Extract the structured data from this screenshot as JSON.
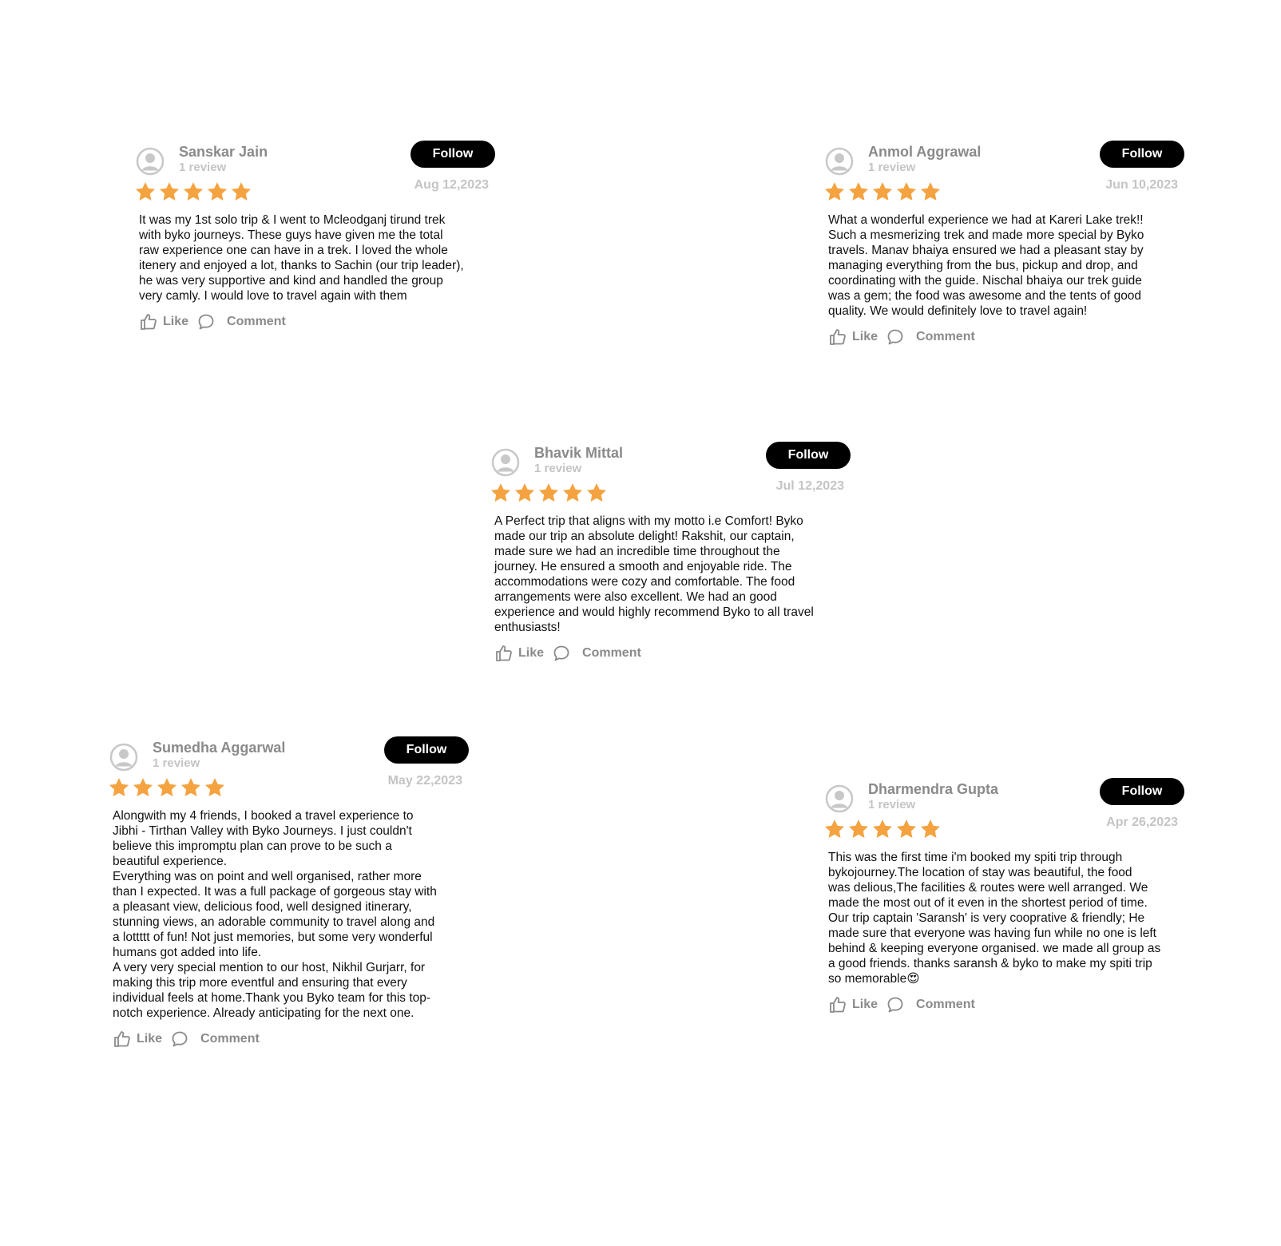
{
  "colors": {
    "star": "#F4A340",
    "follow_bg": "#000000",
    "follow_text": "#FFFFFF",
    "name": "#8A8A8A",
    "muted": "#C4C4C4",
    "body_text": "#111111"
  },
  "icons": {
    "avatar": "user-circle-icon",
    "star": "star-icon",
    "like": "thumbs-up-icon",
    "comment": "comment-bubble-icon"
  },
  "reviews": [
    {
      "name": "Sanskar Jain",
      "review_count": "1 review",
      "follow_label": "Follow",
      "date": "Aug 12,2023",
      "rating": 5,
      "text": "It was my 1st solo trip & I went to Mcleodganj tirund trek\nwith byko journeys. These guys have given me the total\nraw experience one can have in a trek. I loved the whole\nitenery and enjoyed a lot, thanks to Sachin (our trip leader),\nhe was very supportive and kind and handled the group\nvery camly. I would love to travel again with them",
      "like_label": "Like",
      "comment_label": "Comment"
    },
    {
      "name": "Anmol Aggrawal",
      "review_count": "1 review",
      "follow_label": "Follow",
      "date": "Jun 10,2023",
      "rating": 5,
      "text": "What a wonderful experience we had at Kareri Lake trek!!\nSuch a mesmerizing trek and made more special by Byko\ntravels. Manav bhaiya ensured we had a pleasant stay by\nmanaging everything from the bus, pickup and drop, and\ncoordinating with the guide. Nischal bhaiya our trek guide\nwas a gem; the food was awesome and the tents of good\nquality. We would definitely love to travel again!",
      "like_label": "Like",
      "comment_label": "Comment"
    },
    {
      "name": "Bhavik Mittal",
      "review_count": "1 review",
      "follow_label": "Follow",
      "date": "Jul 12,2023",
      "rating": 5,
      "text": "A Perfect trip that aligns with my motto i.e Comfort! Byko\nmade our trip an absolute delight! Rakshit, our captain,\nmade sure we had an incredible time throughout the\njourney. He ensured a smooth and enjoyable ride. The\naccommodations were cozy and comfortable. The food\narrangements were also excellent. We had an good\nexperience and would highly recommend Byko to all travel\nenthusiasts!",
      "like_label": "Like",
      "comment_label": "Comment"
    },
    {
      "name": "Sumedha Aggarwal",
      "review_count": "1 review",
      "follow_label": "Follow",
      "date": "May 22,2023",
      "rating": 5,
      "text": "Alongwith my 4 friends, I booked a travel experience to\nJibhi - Tirthan Valley with Byko Journeys. I just couldn't\nbelieve this impromptu plan can prove to be such a\nbeautiful experience.\nEverything was on point and well organised, rather more\nthan I expected. It was a full package of gorgeous stay with\na pleasant view, delicious food, well designed itinerary,\nstunning views, an adorable community to travel along and\na lottttt of fun! Not just memories, but some very wonderful\nhumans got added into life.\nA very very special mention to our host, Nikhil Gurjarr, for\nmaking this trip more eventful and ensuring that every\nindividual feels at home.Thank you Byko team for this top-\nnotch experience. Already anticipating for the next one.",
      "like_label": "Like",
      "comment_label": "Comment"
    },
    {
      "name": "Dharmendra Gupta",
      "review_count": "1 review",
      "follow_label": "Follow",
      "date": "Apr 26,2023",
      "rating": 5,
      "text": "This was the first time i'm booked my spiti trip through\nbykojourney.The location of stay was beautiful, the food\nwas delious,The facilities & routes were well arranged. We\nmade the most out of it even in the shortest period of time.\nOur trip captain 'Saransh' is very coopm... ",
      "like_label": "Like",
      "comment_label": "Comment"
    }
  ]
}
